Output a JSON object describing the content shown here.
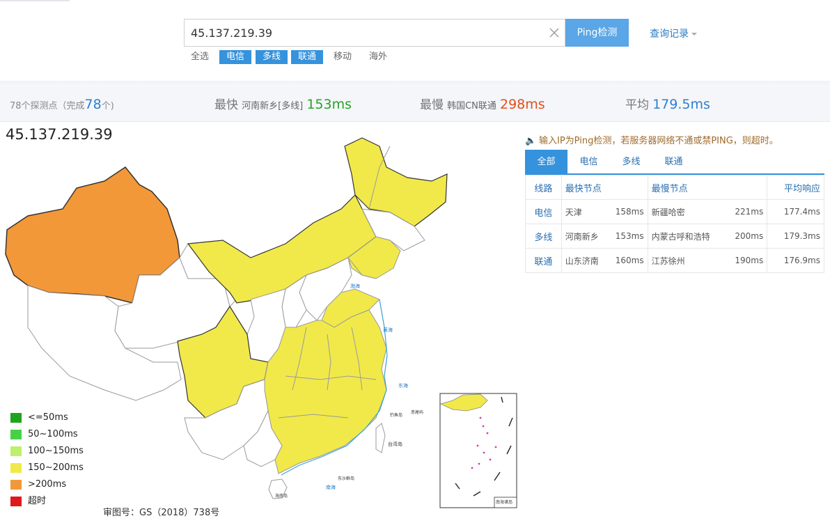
{
  "search": {
    "value": "45.137.219.39",
    "button_label": "Ping检测",
    "history_label": "查询记录"
  },
  "filters": [
    {
      "label": "全选",
      "active": false
    },
    {
      "label": "电信",
      "active": true
    },
    {
      "label": "多线",
      "active": true
    },
    {
      "label": "联通",
      "active": true
    },
    {
      "label": "移动",
      "active": false
    },
    {
      "label": "海外",
      "active": false
    }
  ],
  "stats": {
    "points_prefix": "78个探测点（完成",
    "points_done": "78",
    "points_suffix": "个)",
    "fastest_label": "最快",
    "fastest_node": "河南新乡[多线]",
    "fastest_value": "153ms",
    "slowest_label": "最慢",
    "slowest_node": "韩国CN联通",
    "slowest_value": "298ms",
    "avg_label": "平均",
    "avg_value": "179.5ms"
  },
  "map": {
    "ip_title": "45.137.219.39",
    "approval": "审图号：GS（2018）738号",
    "legend": [
      {
        "label": "<=50ms",
        "color": "#1ea41e"
      },
      {
        "label": "50~100ms",
        "color": "#46d246"
      },
      {
        "label": "100~150ms",
        "color": "#bdf06b"
      },
      {
        "label": "150~200ms",
        "color": "#f1e94a"
      },
      {
        "label": ">200ms",
        "color": "#f39838"
      },
      {
        "label": "超时",
        "color": "#e0191d"
      }
    ],
    "sea_labels": [
      "渤海",
      "黄海",
      "东海",
      "南海",
      "台湾岛",
      "海南岛",
      "东沙群岛",
      "钓鱼岛",
      "赤尾屿",
      "南海诸岛"
    ]
  },
  "notice": "输入IP为Ping检测，若服务器网络不通或禁PING，则超时。",
  "panel": {
    "tabs": [
      {
        "label": "全部",
        "active": true
      },
      {
        "label": "电信",
        "active": false
      },
      {
        "label": "多线",
        "active": false
      },
      {
        "label": "联通",
        "active": false
      }
    ],
    "headers": {
      "line": "线路",
      "fastest": "最快节点",
      "slowest": "最慢节点",
      "avg": "平均响应"
    },
    "rows": [
      {
        "line": "电信",
        "fast_node": "天津",
        "fast_ms": "158ms",
        "slow_node": "新疆哈密",
        "slow_ms": "221ms",
        "avg": "177.4ms"
      },
      {
        "line": "多线",
        "fast_node": "河南新乡",
        "fast_ms": "153ms",
        "slow_node": "内蒙古呼和浩特",
        "slow_ms": "200ms",
        "avg": "179.3ms"
      },
      {
        "line": "联通",
        "fast_node": "山东济南",
        "fast_ms": "160ms",
        "slow_node": "江苏徐州",
        "slow_ms": "190ms",
        "avg": "176.9ms"
      }
    ]
  }
}
